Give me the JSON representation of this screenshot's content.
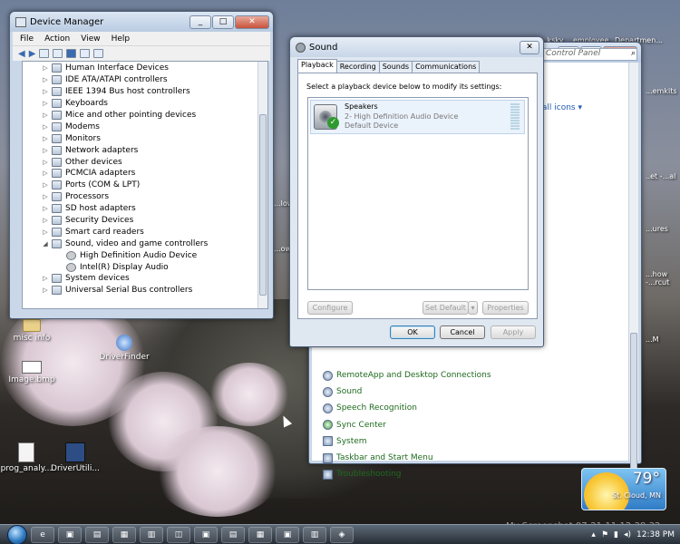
{
  "desktop": {
    "icons_left": [
      {
        "label": "misc info"
      },
      {
        "label": "Image.bmp"
      },
      {
        "label": "prog_analy..."
      },
      {
        "label": "DriverUtili..."
      }
    ],
    "icon_driverfinder": "DriverFinder",
    "right_edge_fragments": [
      "...ksky",
      "employee...",
      "Departmen...",
      "...emkits",
      "..et -...al",
      "...ures",
      "...how -...rcut",
      "...M"
    ],
    "behind_fragments": [
      "...low",
      "...ow"
    ]
  },
  "device_manager": {
    "title": "Device Manager",
    "menu": [
      "File",
      "Action",
      "View",
      "Help"
    ],
    "tree": [
      {
        "label": "Human Interface Devices",
        "expander": "▷",
        "child": false
      },
      {
        "label": "IDE ATA/ATAPI controllers",
        "expander": "▷",
        "child": false
      },
      {
        "label": "IEEE 1394 Bus host controllers",
        "expander": "▷",
        "child": false
      },
      {
        "label": "Keyboards",
        "expander": "▷",
        "child": false
      },
      {
        "label": "Mice and other pointing devices",
        "expander": "▷",
        "child": false
      },
      {
        "label": "Modems",
        "expander": "▷",
        "child": false
      },
      {
        "label": "Monitors",
        "expander": "▷",
        "child": false
      },
      {
        "label": "Network adapters",
        "expander": "▷",
        "child": false
      },
      {
        "label": "Other devices",
        "expander": "▷",
        "child": false
      },
      {
        "label": "PCMCIA adapters",
        "expander": "▷",
        "child": false
      },
      {
        "label": "Ports (COM & LPT)",
        "expander": "▷",
        "child": false
      },
      {
        "label": "Processors",
        "expander": "▷",
        "child": false
      },
      {
        "label": "SD host adapters",
        "expander": "▷",
        "child": false
      },
      {
        "label": "Security Devices",
        "expander": "▷",
        "child": false
      },
      {
        "label": "Smart card readers",
        "expander": "▷",
        "child": false
      },
      {
        "label": "Sound, video and game controllers",
        "expander": "◢",
        "child": false
      },
      {
        "label": "High Definition Audio Device",
        "expander": "",
        "child": true
      },
      {
        "label": "Intel(R) Display Audio",
        "expander": "",
        "child": true
      },
      {
        "label": "System devices",
        "expander": "▷",
        "child": false
      },
      {
        "label": "Universal Serial Bus controllers",
        "expander": "▷",
        "child": false
      }
    ]
  },
  "control_panel": {
    "search_placeholder": "Control Panel",
    "view_by": "mall icons ▾",
    "items": [
      {
        "label": "RemoteApp and Desktop Connections"
      },
      {
        "label": "Sound"
      },
      {
        "label": "Speech Recognition"
      },
      {
        "label": "Sync Center"
      },
      {
        "label": "System"
      },
      {
        "label": "Taskbar and Start Menu"
      },
      {
        "label": "Troubleshooting"
      }
    ]
  },
  "sound_dialog": {
    "title": "Sound",
    "tabs": [
      "Playback",
      "Recording",
      "Sounds",
      "Communications"
    ],
    "active_tab": "Playback",
    "instruction": "Select a playback device below to modify its settings:",
    "device": {
      "name": "Speakers",
      "description": "2- High Definition Audio Device",
      "status": "Default Device"
    },
    "buttons": {
      "configure": "Configure",
      "set_default": "Set Default",
      "dropdown": "▾",
      "properties": "Properties",
      "ok": "OK",
      "cancel": "Cancel",
      "apply": "Apply"
    }
  },
  "weather": {
    "temperature": "79°",
    "city": "St. Cloud, MN"
  },
  "taskbar": {
    "clock": "12:38 PM"
  },
  "watermark": "My Screenshot 07-21-11 12:38:32"
}
